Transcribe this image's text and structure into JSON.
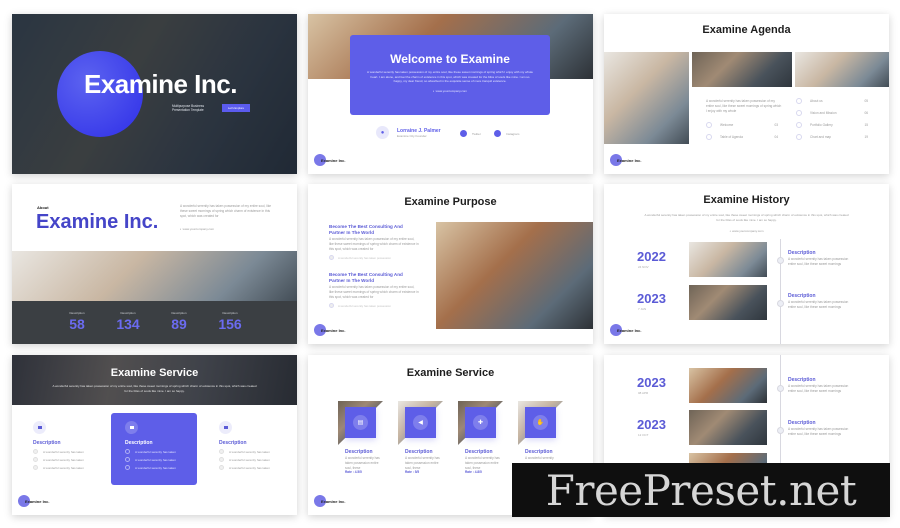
{
  "brand_label": "Examine Inc.",
  "accent_color": "#5e5ee8",
  "lorem_short": "A wonderful serenity has taken possession of my entire soul, like these sweet mornings of spring which charm of existence in this spot, which was created for",
  "slides": {
    "cover": {
      "title": "Examine Inc.",
      "subtitle": "Multipurpose Business Presentation Template",
      "button": "Let's Explore"
    },
    "welcome": {
      "title": "Welcome to Examine",
      "body": "A wonderful serenity has taken possession of my entire soul, like these sweet mornings of spring which I enjoy with my whole heart. I am alone, and feel the charm of existence in this spot, which was created for the bliss of souls like mine. I am so happy, my dear friend, so absorbed in the exquisite sense of mere tranquil existence.",
      "website": "www.yourcompany.com",
      "person_name": "Lorraine J. Palmer",
      "person_role": "Examine City Founder",
      "social": [
        "Twitter",
        "Instagram"
      ]
    },
    "agenda": {
      "title": "Examine Agenda",
      "intro": "A wonderful serenity has taken possession of my entire soul, like these sweet mornings of spring which I enjoy with my whole",
      "items": [
        {
          "label": "Welcome",
          "page": "03"
        },
        {
          "label": "Table of Agenda",
          "page": "04"
        },
        {
          "label": "About us",
          "page": "05"
        },
        {
          "label": "Vision and Mission",
          "page": "06"
        },
        {
          "label": "Portfolio Gallery",
          "page": "15"
        },
        {
          "label": "Chart and map",
          "page": "19"
        }
      ]
    },
    "about": {
      "kicker": "About",
      "title": "Examine Inc.",
      "body": "A wonderful serenity has taken possession of my entire soul, like these sweet mornings of spring which charm of existence in this spot, which was created for",
      "website": "www.yourcompany.com",
      "stats": [
        {
          "label": "Description",
          "value": "58"
        },
        {
          "label": "Description",
          "value": "134"
        },
        {
          "label": "Description",
          "value": "89"
        },
        {
          "label": "Description",
          "value": "156"
        }
      ]
    },
    "purpose": {
      "title": "Examine Purpose",
      "blocks": [
        {
          "heading": "Become The Best Consulting And Partner In The World",
          "body": "A wonderful serenity has taken possession of my entire soul, like these sweet mornings of spring which charm of existence in this spot, which was created for",
          "link": "A wonderful serenity has taken possession"
        },
        {
          "heading": "Become The Best Consulting And Partner In The World",
          "body": "A wonderful serenity has taken possession of my entire soul, like these sweet mornings of spring which charm of existence in this spot, which was created for",
          "link": "A wonderful serenity has taken possession"
        }
      ]
    },
    "history": {
      "title": "Examine History",
      "intro": "A wonderful serenity has taken possession of my entire soul, like these sweet mornings of spring which charm of existence in this spot, which was created for the bliss of souls like mine. I am so happy.",
      "website": "www.yourcompany.com",
      "entries": [
        {
          "year": "2022",
          "date": "24 NOV",
          "heading": "Description",
          "body": "A wonderful serenity has taken possession entire soul, like these sweet mornings"
        },
        {
          "year": "2023",
          "date": "7 JAN",
          "heading": "Description",
          "body": "A wonderful serenity has taken possession entire soul, like these sweet mornings"
        }
      ]
    },
    "service1": {
      "title": "Examine Service",
      "intro": "A wonderful serenity has taken possession of my entire soul, like these sweet mornings of spring which charm of existence in this spot, which was created for the bliss of souls like mine. I am so happy.",
      "columns": [
        {
          "heading": "Description",
          "items": [
            "A wonderful serenity has taken",
            "A wonderful serenity has taken",
            "A wonderful serenity has taken"
          ]
        },
        {
          "heading": "Description",
          "items": [
            "A wonderful serenity has taken",
            "A wonderful serenity has taken",
            "A wonderful serenity has taken"
          ]
        },
        {
          "heading": "Description",
          "items": [
            "A wonderful serenity has taken",
            "A wonderful serenity has taken",
            "A wonderful serenity has taken"
          ]
        }
      ]
    },
    "service2": {
      "title": "Examine Service",
      "items": [
        {
          "heading": "Description",
          "body": "A wonderful serenity has taken possession entire soul, these",
          "rate": "Rate : 4.5/5"
        },
        {
          "heading": "Description",
          "body": "A wonderful serenity has taken possession entire soul, these",
          "rate": "Rate : 5/5"
        },
        {
          "heading": "Description",
          "body": "A wonderful serenity has taken possession entire soul, these",
          "rate": "Rate : 4.8/5"
        },
        {
          "heading": "Description",
          "body": "A wonderful serenity",
          "rate": ""
        }
      ]
    },
    "history2": {
      "entries": [
        {
          "year": "2023",
          "date": "08 APR",
          "heading": "Description",
          "body": "A wonderful serenity has taken possession entire soul, like these sweet mornings"
        },
        {
          "year": "2023",
          "date": "12 OCT",
          "heading": "Description",
          "body": "A wonderful serenity has taken possession entire soul, like these sweet mornings"
        }
      ]
    }
  },
  "watermark": "FreePreset.net"
}
